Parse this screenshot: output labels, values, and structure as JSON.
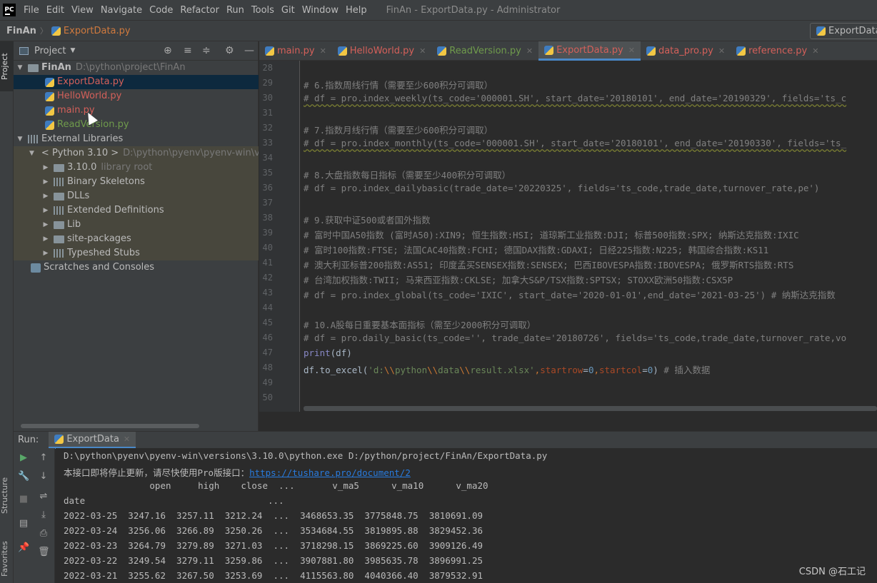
{
  "menubar": {
    "logo": "PC",
    "items": [
      "File",
      "Edit",
      "View",
      "Navigate",
      "Code",
      "Refactor",
      "Run",
      "Tools",
      "Git",
      "Window",
      "Help"
    ],
    "window_title": "FinAn - ExportData.py - Administrator"
  },
  "navbar": {
    "project": "FinAn",
    "file": "ExportData.py",
    "run_config": "ExportData"
  },
  "side_tabs": {
    "project": "Project",
    "structure": "Structure",
    "favorites": "Favorites"
  },
  "project_panel": {
    "title": "Project",
    "tree": [
      {
        "label": "FinAn",
        "path": "D:\\python\\project\\FinAn"
      },
      {
        "label": "ExportData.py"
      },
      {
        "label": "HelloWorld.py"
      },
      {
        "label": "main.py"
      },
      {
        "label": "ReadVersion.py"
      },
      {
        "label": "External Libraries"
      },
      {
        "label": "< Python 3.10 >",
        "path": "D:\\python\\pyenv\\pyenv-win\\ver"
      },
      {
        "label": "3.10.0",
        "path": "library root"
      },
      {
        "label": "Binary Skeletons"
      },
      {
        "label": "DLLs"
      },
      {
        "label": "Extended Definitions"
      },
      {
        "label": "Lib"
      },
      {
        "label": "site-packages"
      },
      {
        "label": "Typeshed Stubs"
      },
      {
        "label": "Scratches and Consoles"
      }
    ]
  },
  "editor": {
    "tabs": [
      "main.py",
      "HelloWorld.py",
      "ReadVersion.py",
      "ExportData.py",
      "data_pro.py",
      "reference.py"
    ],
    "active_tab": "ExportData.py",
    "line_numbers": [
      "28",
      "29",
      "30",
      "31",
      "32",
      "33",
      "34",
      "35",
      "36",
      "37",
      "38",
      "39",
      "40",
      "41",
      "42",
      "43",
      "44",
      "45",
      "46",
      "47",
      "48",
      "49",
      "50"
    ],
    "lines": {
      "l29": "# 6.指数周线行情（需要至少600积分可调取）",
      "l30": "# df = pro.index_weekly(ts_code='000001.SH', start_date='20180101', end_date='20190329', fields='ts_c",
      "l32": "# 7.指数月线行情（需要至少600积分可调取）",
      "l33": "# df = pro.index_monthly(ts_code='000001.SH', start_date='20180101', end_date='20190330', fields='ts_",
      "l35": "# 8.大盘指数每日指标（需要至少400积分可调取）",
      "l36": "# df = pro.index_dailybasic(trade_date='20220325', fields='ts_code,trade_date,turnover_rate,pe')",
      "l38": "# 9.获取中证500或者国外指数",
      "l39": "# 富时中国A50指数 (富时A50):XIN9; 恒生指数:HSI; 道琼斯工业指数:DJI; 标普500指数:SPX; 纳斯达克指数:IXIC",
      "l40": "# 富时100指数:FTSE; 法国CAC40指数:FCHI; 德国DAX指数:GDAXI; 日经225指数:N225; 韩国综合指数:KS11",
      "l41": "# 澳大利亚标普200指数:AS51; 印度孟买SENSEX指数:SENSEX; 巴西IBOVESPA指数:IBOVESPA; 俄罗斯RTS指数:RTS",
      "l42": "# 台湾加权指数:TWII; 马来西亚指数:CKLSE; 加拿大S&P/TSX指数:SPTSX; STOXX欧洲50指数:CSX5P",
      "l43": "# df = pro.index_global(ts_code='IXIC', start_date='2020-01-01',end_date='2021-03-25') # 纳斯达克指数",
      "l45": "# 10.A股每日重要基本面指标（需至少2000积分可调取）",
      "l46": "# df = pro.daily_basic(ts_code='', trade_date='20180726', fields='ts_code,trade_date,turnover_rate,vo",
      "l47": {
        "func": "print",
        "args": "(df)"
      },
      "l48": {
        "obj": "df.to_excel(",
        "str_open": "'d:",
        "esc1": "\\\\",
        "s1": "python",
        "esc2": "\\\\",
        "s2": "data",
        "esc3": "\\\\",
        "s3": "result.xlsx'",
        "c1": ",",
        "k1": "startrow",
        "eq1": "=",
        "n1": "0",
        "c2": ",",
        "k2": "startcol",
        "eq2": "=",
        "n2": "0",
        "close": ")",
        "comment": " # 插入数据"
      }
    }
  },
  "run_panel": {
    "label": "Run:",
    "tab": "ExportData",
    "console": {
      "cmd": "D:\\python\\pyenv\\pyenv-win\\versions\\3.10.0\\python.exe D:/python/project/FinAn/ExportData.py",
      "notice_prefix": "本接口即将停止更新，请尽快使用Pro版接口：",
      "notice_link": "https://tushare.pro/document/2",
      "header": "                open     high    close  ...       v_ma5      v_ma10      v_ma20",
      "index_row": "date                                  ...",
      "rows": [
        "2022-03-25  3247.16  3257.11  3212.24  ...  3468653.35  3775848.75  3810691.09",
        "2022-03-24  3256.06  3266.89  3250.26  ...  3534684.55  3819895.88  3829452.36",
        "2022-03-23  3264.79  3279.89  3271.03  ...  3718298.15  3869225.60  3909126.49",
        "2022-03-22  3249.54  3279.11  3259.86  ...  3907881.80  3985635.78  3896991.25",
        "2022-03-21  3255.62  3267.50  3253.69  ...  4115563.80  4040366.40  3879532.91"
      ]
    }
  },
  "watermark": "CSDN @石工记"
}
